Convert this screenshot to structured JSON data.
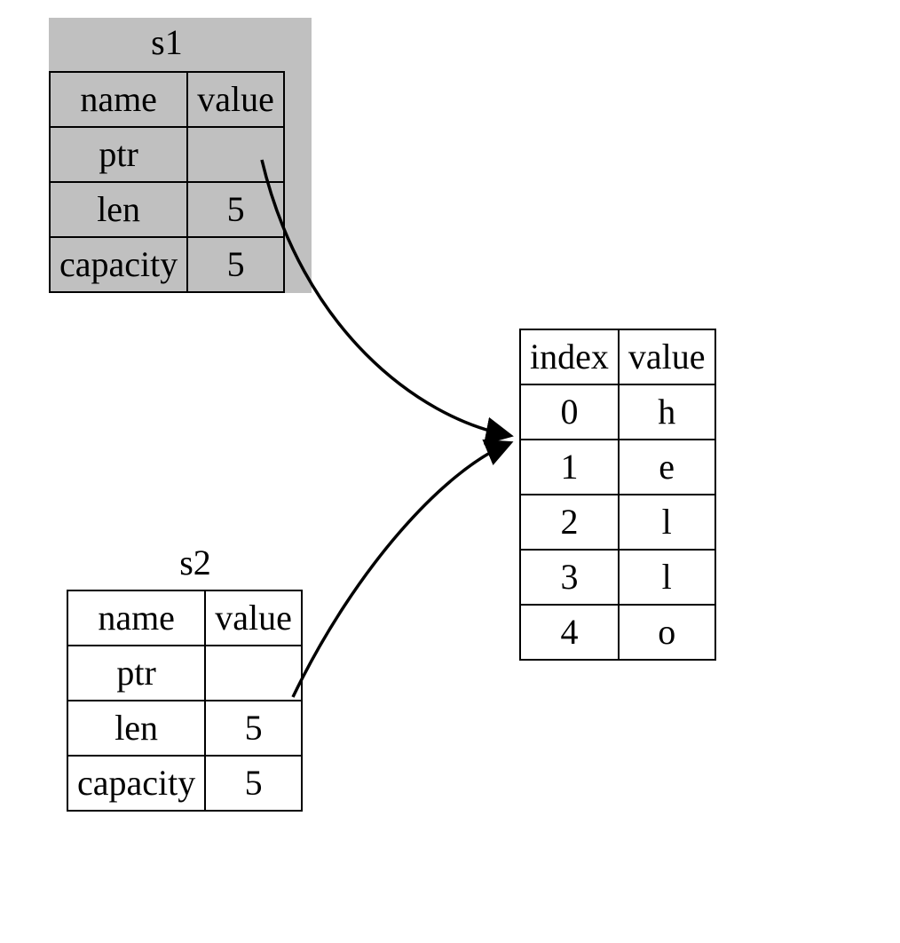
{
  "s1": {
    "title": "s1",
    "headers": {
      "name": "name",
      "value": "value"
    },
    "rows": [
      {
        "name": "ptr",
        "value": ""
      },
      {
        "name": "len",
        "value": "5"
      },
      {
        "name": "capacity",
        "value": "5"
      }
    ]
  },
  "s2": {
    "title": "s2",
    "headers": {
      "name": "name",
      "value": "value"
    },
    "rows": [
      {
        "name": "ptr",
        "value": ""
      },
      {
        "name": "len",
        "value": "5"
      },
      {
        "name": "capacity",
        "value": "5"
      }
    ]
  },
  "heap": {
    "headers": {
      "index": "index",
      "value": "value"
    },
    "rows": [
      {
        "index": "0",
        "value": "h"
      },
      {
        "index": "1",
        "value": "e"
      },
      {
        "index": "2",
        "value": "l"
      },
      {
        "index": "3",
        "value": "l"
      },
      {
        "index": "4",
        "value": "o"
      }
    ]
  }
}
